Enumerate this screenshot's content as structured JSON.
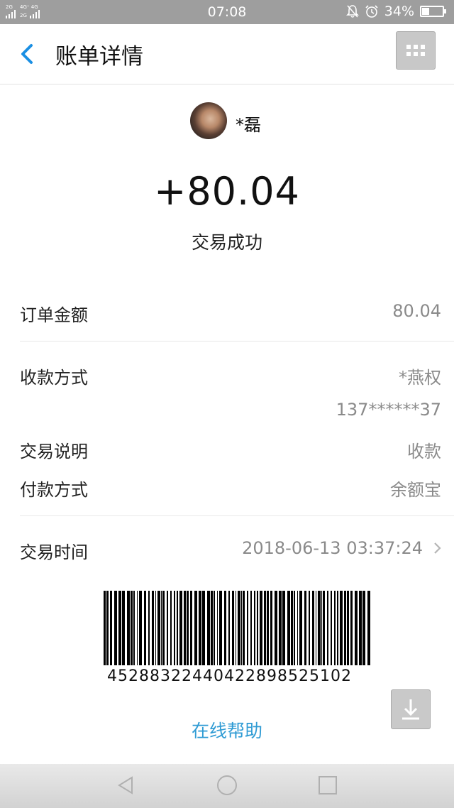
{
  "status_bar": {
    "sim1_label": "2G",
    "sim2_label": "4G⁺ 4G",
    "sim2_sub": "2G",
    "time": "07:08",
    "battery_text": "34%",
    "battery_level": 0.34,
    "icons": [
      "mute-bell-icon",
      "alarm-icon",
      "battery-icon"
    ]
  },
  "header": {
    "title": "账单详情",
    "back_icon": "chevron-left-icon",
    "menu_icon": "grid-menu-icon"
  },
  "payee": {
    "name": "*磊"
  },
  "summary": {
    "amount": "+80.04",
    "status": "交易成功"
  },
  "details": [
    {
      "label": "订单金额",
      "value": "80.04"
    },
    {
      "label": "收款方式",
      "value": "*燕权",
      "value2": "137******37"
    },
    {
      "label": "交易说明",
      "value": "收款"
    },
    {
      "label": "付款方式",
      "value": "余额宝"
    },
    {
      "label": "交易时间",
      "value": "2018-06-13 03:37:24"
    }
  ],
  "barcode": {
    "number": "45288322440422898525102"
  },
  "help_link": "在线帮助",
  "colors": {
    "accent": "#2f9bd4",
    "back_arrow": "#1a8fe3",
    "status_bar": "#9e9e9e",
    "value_text": "#8a8a8a"
  },
  "nav": {
    "icons": [
      "back-triangle-icon",
      "home-circle-icon",
      "recent-square-icon"
    ]
  }
}
